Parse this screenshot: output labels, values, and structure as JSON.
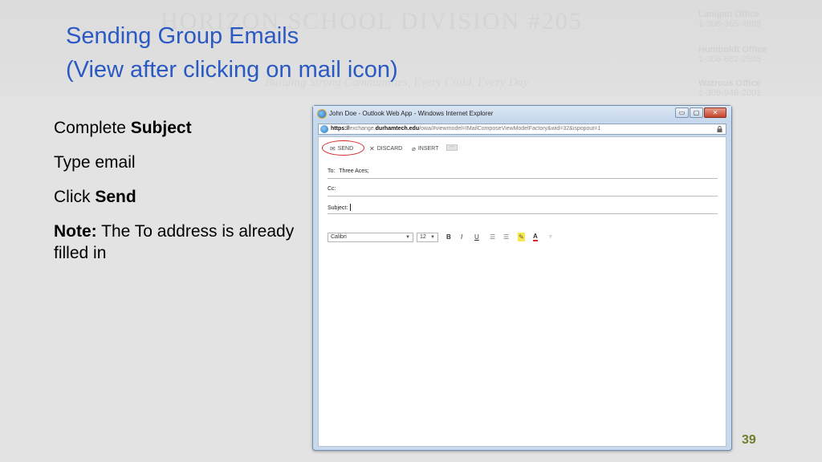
{
  "slide": {
    "title_line1": "Sending Group Emails",
    "title_line2": "(View after clicking on mail icon)",
    "page_number": "39",
    "bullets": [
      {
        "prefix": "Complete ",
        "bold": "Subject",
        "suffix": ""
      },
      {
        "prefix": "Type email",
        "bold": "",
        "suffix": ""
      },
      {
        "prefix": "Click ",
        "bold": "Send",
        "suffix": ""
      },
      {
        "prefix": "",
        "bold": "Note:",
        "suffix": " The To address is already filled in"
      }
    ]
  },
  "watermark": {
    "title": "HORIZON SCHOOL DIVISION #205",
    "motto": "Building Strong Communities, Every Child, Every Day",
    "offices": [
      {
        "name": "Lanigan Office",
        "address": "1-306-365-4888"
      },
      {
        "name": "Humboldt Office",
        "address": "1-306-682-2505"
      },
      {
        "name": "Watrous Office",
        "address": "1-306-946-2001"
      }
    ]
  },
  "browser": {
    "window_title": "John Doe - Outlook Web App - Windows Internet Explorer",
    "url_scheme": "https://",
    "url_pre_host": "exchange.",
    "url_host": "durhamtech.edu",
    "url_path": "/owa/#viewmodel=IMailComposeViewModelFactory&wid=32&ispopout=1",
    "buttons": {
      "minimize": "▭",
      "maximize": "▢",
      "close": "✕"
    }
  },
  "compose": {
    "toolbar": {
      "send": "SEND",
      "discard": "DISCARD",
      "insert": "INSERT",
      "more": "···"
    },
    "to_label": "To:",
    "to_value": "Three Aces;",
    "cc_label": "Cc:",
    "subject_label": "Subject:",
    "font_name": "Calibri",
    "font_size": "12",
    "format_buttons": [
      "B",
      "I",
      "U",
      "☰",
      "☰",
      "✎",
      "A",
      "▿"
    ]
  },
  "colors": {
    "title": "#2b59c3",
    "page_number": "#6f7e2c",
    "send_highlight": "#d8282b"
  }
}
